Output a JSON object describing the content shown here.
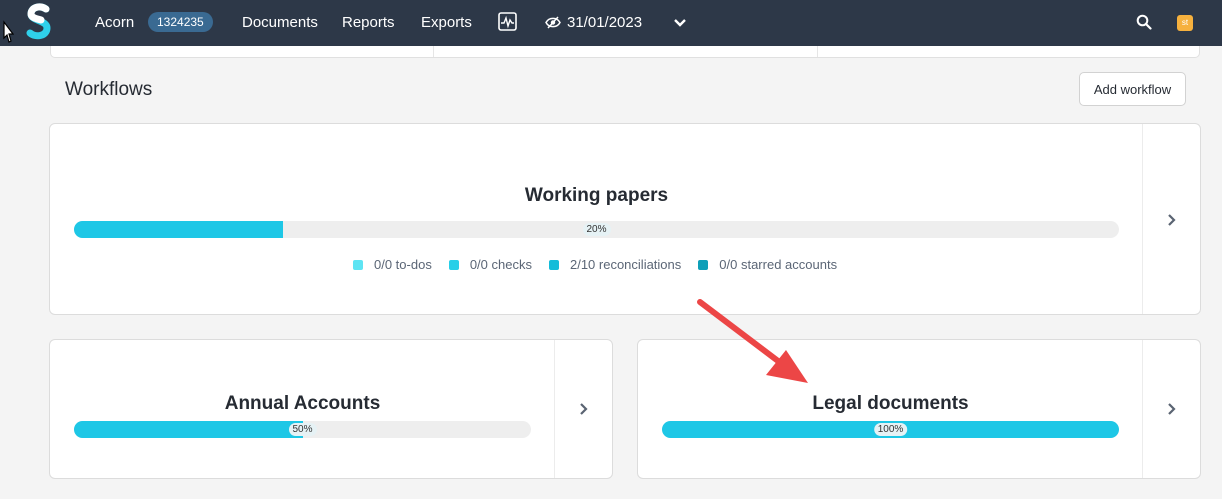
{
  "nav": {
    "client_name": "Acorn",
    "client_id": "1324235",
    "documents": "Documents",
    "reports": "Reports",
    "exports": "Exports",
    "period_date": "31/01/2023",
    "avatar_initials": "st"
  },
  "workflows": {
    "section_title": "Workflows",
    "add_button_label": "Add workflow",
    "working_papers": {
      "title": "Working papers",
      "progress": 20,
      "progress_label": "20%",
      "legend": [
        {
          "label": "0/0 to-dos",
          "color": "#5ee4f3"
        },
        {
          "label": "0/0 checks",
          "color": "#27cfe8"
        },
        {
          "label": "2/10 reconciliations",
          "color": "#14bcd9"
        },
        {
          "label": "0/0 starred accounts",
          "color": "#0e9fb8"
        }
      ]
    },
    "annual_accounts": {
      "title": "Annual Accounts",
      "progress": 50,
      "progress_label": "50%"
    },
    "legal_documents": {
      "title": "Legal documents",
      "progress": 100,
      "progress_label": "100%"
    }
  },
  "colors": {
    "nav_bg": "#2d3848",
    "progress_fill": "#1ec7e6",
    "annotation_arrow": "#ec4646",
    "badge_bg": "#3a6a92",
    "avatar_bg": "#f6b13e"
  }
}
